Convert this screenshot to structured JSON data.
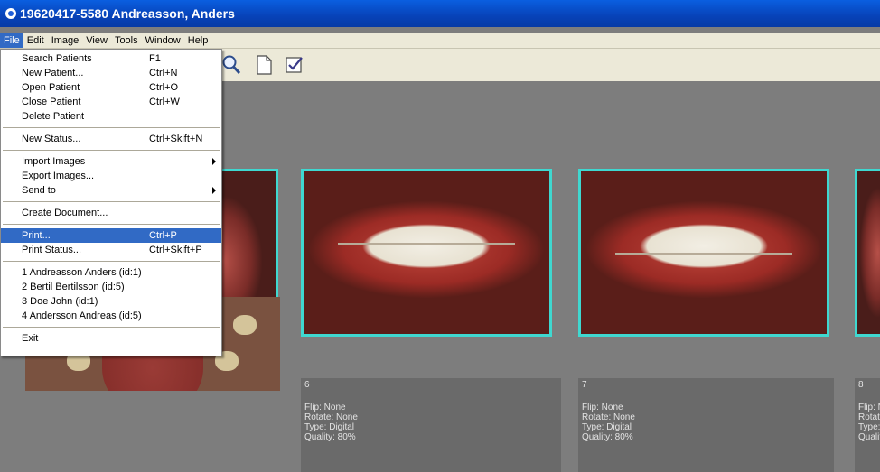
{
  "window": {
    "title": "19620417-5580 Andreasson, Anders"
  },
  "menubar": {
    "items": [
      {
        "label": "File",
        "active": true
      },
      {
        "label": "Edit"
      },
      {
        "label": "Image"
      },
      {
        "label": "View"
      },
      {
        "label": "Tools"
      },
      {
        "label": "Window"
      },
      {
        "label": "Help"
      }
    ]
  },
  "toolbar": {
    "icons": [
      "zoom-icon",
      "new-document-icon",
      "checklist-icon"
    ]
  },
  "file_menu": {
    "groups": [
      [
        {
          "label": "Search Patients",
          "shortcut": "F1"
        },
        {
          "label": "New Patient...",
          "shortcut": "Ctrl+N"
        },
        {
          "label": "Open Patient",
          "shortcut": "Ctrl+O"
        },
        {
          "label": "Close Patient",
          "shortcut": "Ctrl+W"
        },
        {
          "label": "Delete Patient",
          "shortcut": ""
        }
      ],
      [
        {
          "label": "New Status...",
          "shortcut": "Ctrl+Skift+N"
        }
      ],
      [
        {
          "label": "Import Images",
          "shortcut": "",
          "submenu": true
        },
        {
          "label": "Export Images...",
          "shortcut": ""
        },
        {
          "label": "Send to",
          "shortcut": "",
          "submenu": true
        }
      ],
      [
        {
          "label": "Create Document...",
          "shortcut": ""
        }
      ],
      [
        {
          "label": "Print...",
          "shortcut": "Ctrl+P",
          "highlighted": true
        },
        {
          "label": "Print Status...",
          "shortcut": "Ctrl+Skift+P"
        }
      ],
      [
        {
          "label": "1 Andreasson Anders (id:1)",
          "shortcut": ""
        },
        {
          "label": "2 Bertil Bertilsson (id:5)",
          "shortcut": ""
        },
        {
          "label": "3 Doe John (id:1)",
          "shortcut": ""
        },
        {
          "label": "4 Andersson Andreas (id:5)",
          "shortcut": ""
        }
      ],
      [
        {
          "label": "Exit",
          "shortcut": ""
        }
      ]
    ]
  },
  "image_info": [
    {
      "number": "6",
      "flip": "Flip: None",
      "rotate": "Rotate: None",
      "type": "Type: Digital",
      "quality": "Quality: 80%"
    },
    {
      "number": "7",
      "flip": "Flip: None",
      "rotate": "Rotate: None",
      "type": "Type: Digital",
      "quality": "Quality: 80%"
    },
    {
      "number": "8",
      "flip": "Flip: N",
      "rotate": "Rotat",
      "type": "Type:",
      "quality": "Qualit"
    }
  ],
  "colors": {
    "selection_border": "#3fd8d0",
    "menu_highlight": "#316ac5",
    "titlebar": "#0a5fe0"
  }
}
